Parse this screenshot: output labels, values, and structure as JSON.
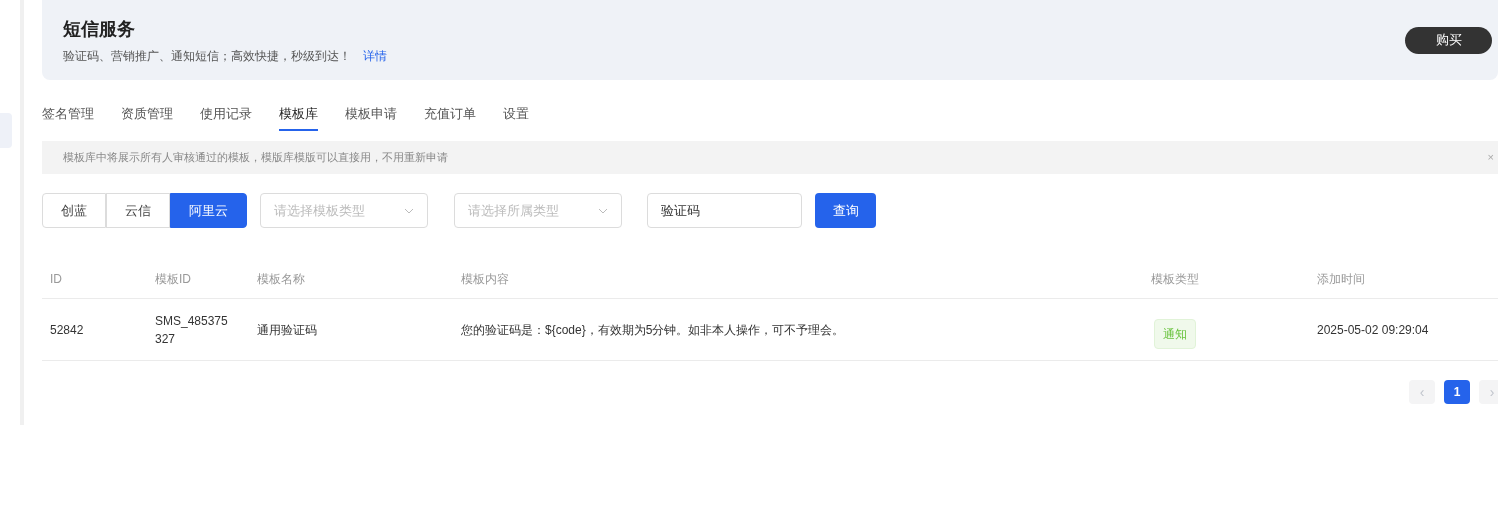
{
  "header": {
    "title": "短信服务",
    "subtitle": "验证码、营销推广、通知短信；高效快捷，秒级到达！",
    "link": "详情",
    "buy_button": "购买"
  },
  "tabs": [
    {
      "label": "签名管理",
      "selected": false
    },
    {
      "label": "资质管理",
      "selected": false
    },
    {
      "label": "使用记录",
      "selected": false
    },
    {
      "label": "模板库",
      "selected": true
    },
    {
      "label": "模板申请",
      "selected": false
    },
    {
      "label": "充值订单",
      "selected": false
    },
    {
      "label": "设置",
      "selected": false
    }
  ],
  "notice": {
    "text": "模板库中将展示所有人审核通过的模板，模版库模版可以直接用，不用重新申请",
    "close": "×"
  },
  "providers": [
    {
      "label": "创蓝",
      "selected": false
    },
    {
      "label": "云信",
      "selected": false
    },
    {
      "label": "阿里云",
      "selected": true
    }
  ],
  "filters": {
    "template_type": {
      "placeholder": "请选择模板类型"
    },
    "category": {
      "placeholder": "请选择所属类型"
    },
    "keyword": {
      "value": "验证码"
    },
    "query_button": "查询"
  },
  "table": {
    "columns": [
      "ID",
      "模板ID",
      "模板名称",
      "模板内容",
      "模板类型",
      "添加时间"
    ],
    "rows": [
      {
        "id": "52842",
        "template_id": "SMS_485375327",
        "name": "通用验证码",
        "content": "您的验证码是：${code}，有效期为5分钟。如非本人操作，可不予理会。",
        "type": "通知",
        "color": "#67c23a",
        "added": "2025-05-02 09:29:04"
      }
    ]
  },
  "pagination": {
    "prev": "‹",
    "pages": [
      {
        "label": "1",
        "selected": true
      }
    ],
    "next": "›"
  }
}
